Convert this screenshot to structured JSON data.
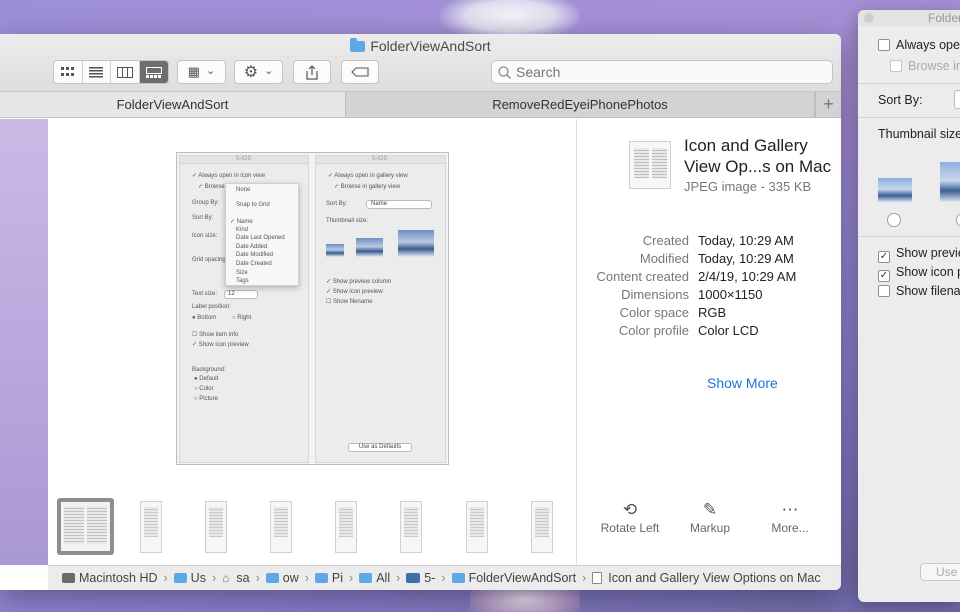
{
  "finder": {
    "title": "FolderViewAndSort",
    "search_placeholder": "Search",
    "toolbar": {
      "view_icon": "icon-view-icon",
      "list_icon": "list-view-icon",
      "column_icon": "column-view-icon",
      "gallery_icon": "gallery-view-icon",
      "group_glyph": "▦",
      "chevron": "⌄",
      "gear_glyph": "⚙",
      "share_glyph": "⇪",
      "tag_glyph": "⬭"
    },
    "tabs": [
      {
        "label": "FolderViewAndSort",
        "selected": true
      },
      {
        "label": "RemoveRedEyeiPhonePhotos",
        "selected": false
      }
    ],
    "tab_add": "+"
  },
  "preview_image": {
    "left_pane": {
      "title": "5-iOS",
      "items": [
        "✓ Always open in icon view",
        "✓ Browse",
        "Group By:",
        "Sort By:",
        "Icon size:",
        "Grid spacing",
        "Text size:",
        "12",
        "Label position:",
        "● Bottom",
        "○ Right",
        "☐ Show item info",
        "✓ Show icon preview",
        "Background:",
        "● Default",
        "○ Color",
        "○ Picture"
      ],
      "menu": [
        "None",
        "Snap to Grid",
        "✓ Name",
        "Kind",
        "Date Last Opened",
        "Date Added",
        "Date Modified",
        "Date Created",
        "Size",
        "Tags"
      ]
    },
    "right_pane": {
      "title": "5-iOS",
      "items": [
        "✓ Always open in gallery view",
        "✓ Browse in gallery view",
        "Sort By:",
        "Name",
        "Thumbnail size:",
        "✓ Show preview column",
        "✓ Show icon preview",
        "☐ Show filename"
      ],
      "defaults_button": "Use as Defaults"
    }
  },
  "info": {
    "name": "Icon and Gallery View Op...s on Mac",
    "kind": "JPEG image - 335 KB",
    "metadata": [
      {
        "key": "Created",
        "value": "Today, 10:29 AM"
      },
      {
        "key": "Modified",
        "value": "Today, 10:29 AM"
      },
      {
        "key": "Content created",
        "value": "2/4/19, 10:29 AM"
      },
      {
        "key": "Dimensions",
        "value": "1000×1150"
      },
      {
        "key": "Color space",
        "value": "RGB"
      },
      {
        "key": "Color profile",
        "value": "Color LCD"
      }
    ],
    "show_more": "Show More",
    "actions": [
      {
        "label": "Rotate Left",
        "icon": "rotate-left-icon",
        "glyph": "⟲"
      },
      {
        "label": "Markup",
        "icon": "markup-icon",
        "glyph": "✎"
      },
      {
        "label": "More...",
        "icon": "more-icon",
        "glyph": "⋯"
      }
    ]
  },
  "pathbar": [
    {
      "label": "Macintosh HD",
      "icon": "hd"
    },
    {
      "label": "Us",
      "icon": "folder"
    },
    {
      "label": "sa",
      "icon": "home"
    },
    {
      "label": "ow",
      "icon": "folder"
    },
    {
      "label": "Pi",
      "icon": "folder"
    },
    {
      "label": "All",
      "icon": "folder"
    },
    {
      "label": "5-",
      "icon": "img"
    },
    {
      "label": "FolderViewAndSort",
      "icon": "folder"
    },
    {
      "label": "Icon and Gallery View Options on Mac",
      "icon": "doc"
    }
  ],
  "options_window": {
    "title": "Folder",
    "always_open": "Always oper",
    "browse": "Browse in",
    "sort_by": "Sort By:",
    "thumbnail_size": "Thumbnail size",
    "show_preview": "Show previe",
    "show_icon": "Show icon p",
    "show_filename": "Show filena",
    "use_defaults": "Use"
  }
}
